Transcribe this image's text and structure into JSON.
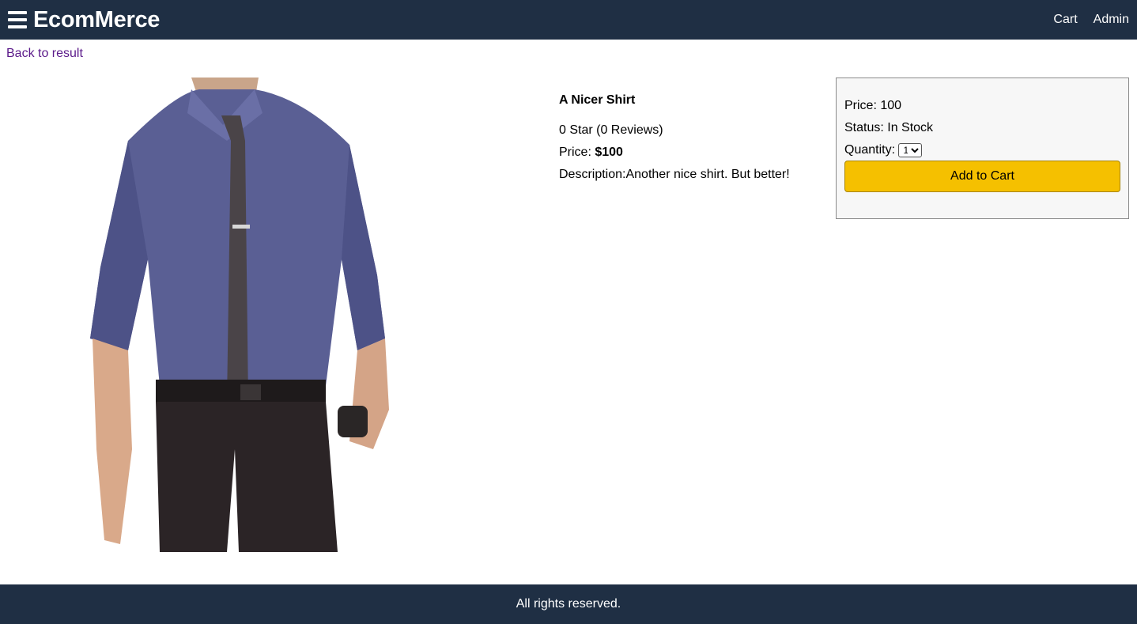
{
  "header": {
    "brand": "EcomMerce",
    "menu_icon": "hamburger-menu-icon",
    "nav": [
      {
        "label": "Cart"
      },
      {
        "label": "Admin"
      }
    ],
    "background_color": "#1f2f44"
  },
  "back_link": "Back to result",
  "product": {
    "image_alt": "A Nicer Shirt",
    "name": "A Nicer Shirt",
    "rating_text": "0 Star (0 Reviews)",
    "price_label": "Price: ",
    "price_value": "$100",
    "description": "Description:Another nice shirt. But better!"
  },
  "action": {
    "price_text": "Price: 100",
    "status_text": "Status: In Stock",
    "quantity_label": "Quantity:",
    "quantity_selected": "1",
    "add_to_cart_label": "Add to Cart",
    "button_color": "#f5c000"
  },
  "footer": {
    "text": "All rights reserved."
  }
}
